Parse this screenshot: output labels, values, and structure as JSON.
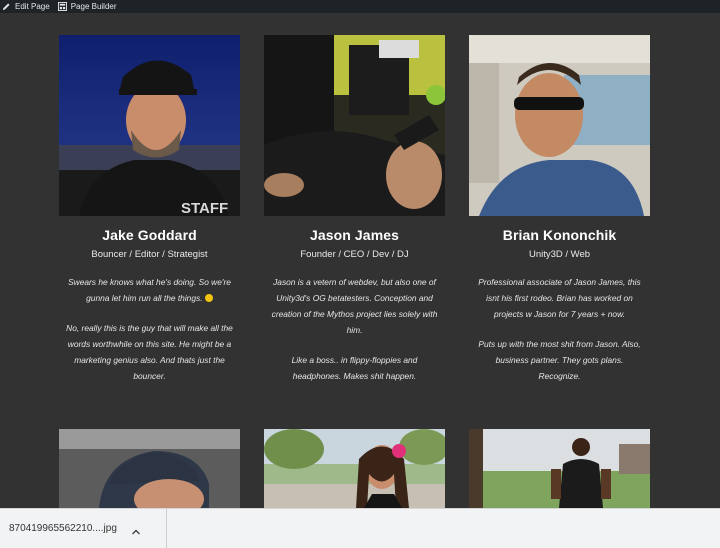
{
  "adminbar": {
    "edit_label": "Edit Page",
    "builder_label": "Page Builder"
  },
  "team": [
    {
      "name": "Jake Goddard",
      "role": "Bouncer / Editor / Strategist",
      "bio": [
        "Swears he knows what he's doing. So we're gunna let him run all the things.",
        "No, really this is the guy that will make all the words worthwhile on this site. He might be a marketing genius also. And thats just the bouncer."
      ],
      "photo_shirt_text": "STAFF"
    },
    {
      "name": "Jason James",
      "role": "Founder / CEO / Dev / DJ",
      "bio": [
        "Jason is a vetern of webdev, but also one of Unity3d's OG betatesters. Conception and creation of the Mythos project lies solely with him.",
        "Like a boss.. in flippy-floppies and headphones. Makes shit happen."
      ]
    },
    {
      "name": "Brian Kononchik",
      "role": "Unity3D / Web",
      "bio": [
        "Professional associate of Jason James, this isnt his first rodeo. Brian has worked on projects w Jason for 7 years + now.",
        "Puts up with the most shit from Jason. Also, business partner. They gots plans. Recognize."
      ]
    }
  ],
  "download": {
    "filename": "870419965562210....jpg"
  },
  "colors": {
    "page_bg": "#323232",
    "admin_bg": "#1d2327",
    "download_bg": "#f1f3f4"
  }
}
